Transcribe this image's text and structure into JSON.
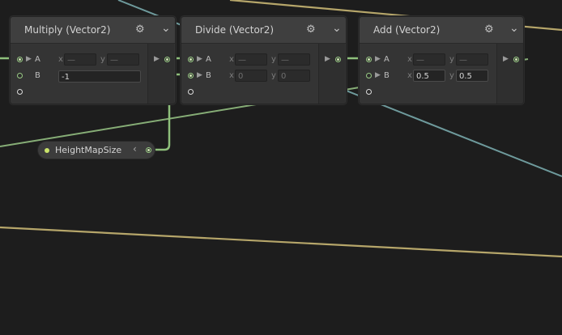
{
  "nodes": [
    {
      "title": "Multiply (Vector2)",
      "inputs": [
        {
          "label": "A",
          "x_label": "x",
          "x_value": "—",
          "y_label": "y",
          "y_value": "—"
        },
        {
          "label": "B",
          "value": "-1"
        },
        {
          "label": ""
        }
      ]
    },
    {
      "title": "Divide (Vector2)",
      "inputs": [
        {
          "label": "A",
          "x_label": "x",
          "x_value": "—",
          "y_label": "y",
          "y_value": "—"
        },
        {
          "label": "B",
          "x_label": "x",
          "x_value": "0",
          "y_label": "y",
          "y_value": "0"
        },
        {
          "label": ""
        }
      ]
    },
    {
      "title": "Add (Vector2)",
      "inputs": [
        {
          "label": "A",
          "x_label": "x",
          "x_value": "—",
          "y_label": "y",
          "y_value": "—"
        },
        {
          "label": "B",
          "x_label": "x",
          "x_value": "0.5",
          "y_label": "y",
          "y_value": "0.5"
        },
        {
          "label": ""
        }
      ]
    }
  ],
  "property_node": {
    "label": "HeightMapSize"
  },
  "icons": {
    "settings": "gear-icon",
    "collapse": "chevron-down-icon",
    "expand_arrow": "chevron-left-icon"
  },
  "colors": {
    "background": "#1d1d1d",
    "vector2_wire": "#8ebf7b",
    "float_wire": "#c9b06a",
    "vector3_wire": "#72a2a8",
    "property_dot": "#c9e36a"
  }
}
